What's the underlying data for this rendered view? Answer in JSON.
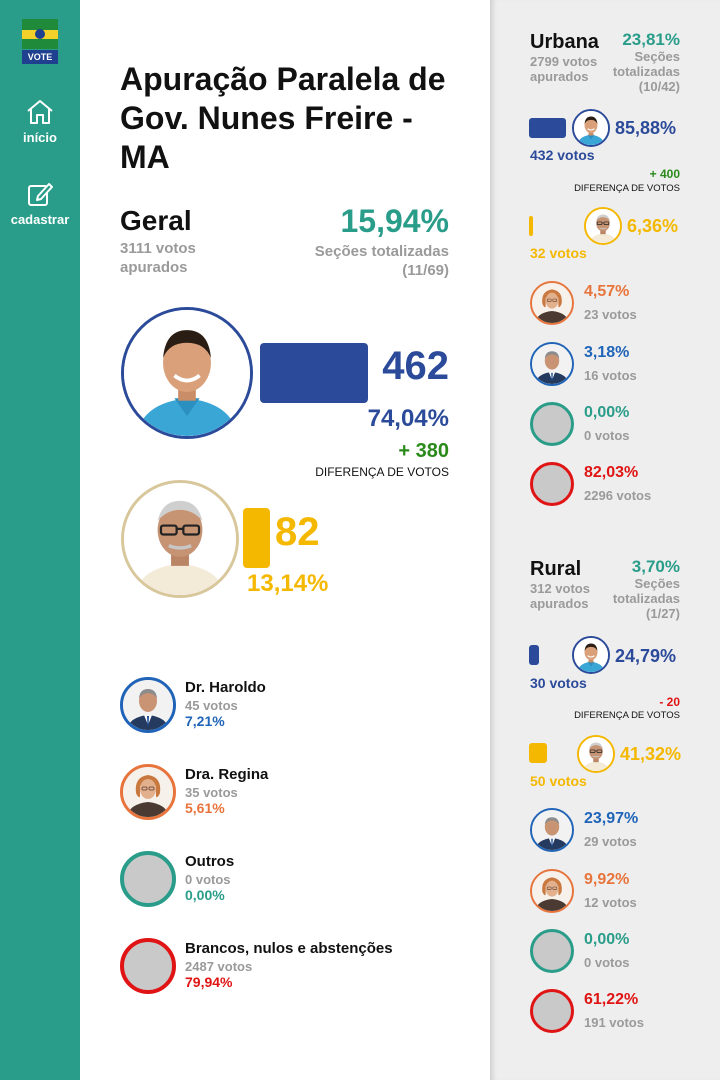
{
  "colors": {
    "teal": "#2a9d8a",
    "blue": "#2b4a9a",
    "yellow": "#f5b800",
    "haroldo": "#1f64b8",
    "regina": "#e8743b",
    "outros": "#2a9d8a",
    "brancos": "#e01414",
    "green": "#2a8a1a"
  },
  "sidebar": {
    "logo_text": "VOTE",
    "items": [
      {
        "label": "início",
        "icon": "home-icon"
      },
      {
        "label": "cadastrar",
        "icon": "edit-icon"
      }
    ]
  },
  "main": {
    "title": "Apuração Paralela de Gov. Nunes Freire - MA",
    "geral": {
      "label": "Geral",
      "votes_text": "3111 votos apurados",
      "pct": "15,94%",
      "sections_text": "Seções totalizadas (11/69)"
    },
    "lead": {
      "votes": "462",
      "pct": "74,04%",
      "diff": "+ 380",
      "diff_label": "DIFERENÇA DE VOTOS",
      "bar_fraction": 0.7404
    },
    "second": {
      "votes": "82",
      "pct": "13,14%",
      "bar_fraction": 0.1314
    },
    "others": [
      {
        "name": "Dr. Haroldo",
        "votes": "45 votos",
        "pct": "7,21%"
      },
      {
        "name": "Dra. Regina",
        "votes": "35 votos",
        "pct": "5,61%"
      },
      {
        "name": "Outros",
        "votes": "0 votos",
        "pct": "0,00%"
      },
      {
        "name": "Brancos, nulos e abstenções",
        "votes": "2487 votos",
        "pct": "79,94%"
      }
    ]
  },
  "urbana": {
    "label": "Urbana",
    "votes_text": "2799 votos apurados",
    "pct": "23,81%",
    "sections_text": "Seções totalizadas (10/42)",
    "lead": {
      "pct": "85,88%",
      "votes": "432 votos",
      "diff": "+ 400",
      "diff_label": "DIFERENÇA DE VOTOS"
    },
    "second": {
      "pct": "6,36%",
      "votes": "32 votos"
    },
    "others": [
      {
        "pct": "4,57%",
        "votes": "23 votos"
      },
      {
        "pct": "3,18%",
        "votes": "16 votos"
      },
      {
        "pct": "0,00%",
        "votes": "0 votos"
      },
      {
        "pct": "82,03%",
        "votes": "2296 votos"
      }
    ]
  },
  "rural": {
    "label": "Rural",
    "votes_text": "312 votos apurados",
    "pct": "3,70%",
    "sections_text": "Seções totalizadas (1/27)",
    "lead": {
      "pct": "24,79%",
      "votes": "30 votos",
      "diff": "- 20",
      "diff_label": "DIFERENÇA DE VOTOS"
    },
    "second": {
      "pct": "41,32%",
      "votes": "50 votos"
    },
    "others": [
      {
        "pct": "23,97%",
        "votes": "29 votos"
      },
      {
        "pct": "9,92%",
        "votes": "12 votos"
      },
      {
        "pct": "0,00%",
        "votes": "0 votos"
      },
      {
        "pct": "61,22%",
        "votes": "191 votos"
      }
    ]
  }
}
